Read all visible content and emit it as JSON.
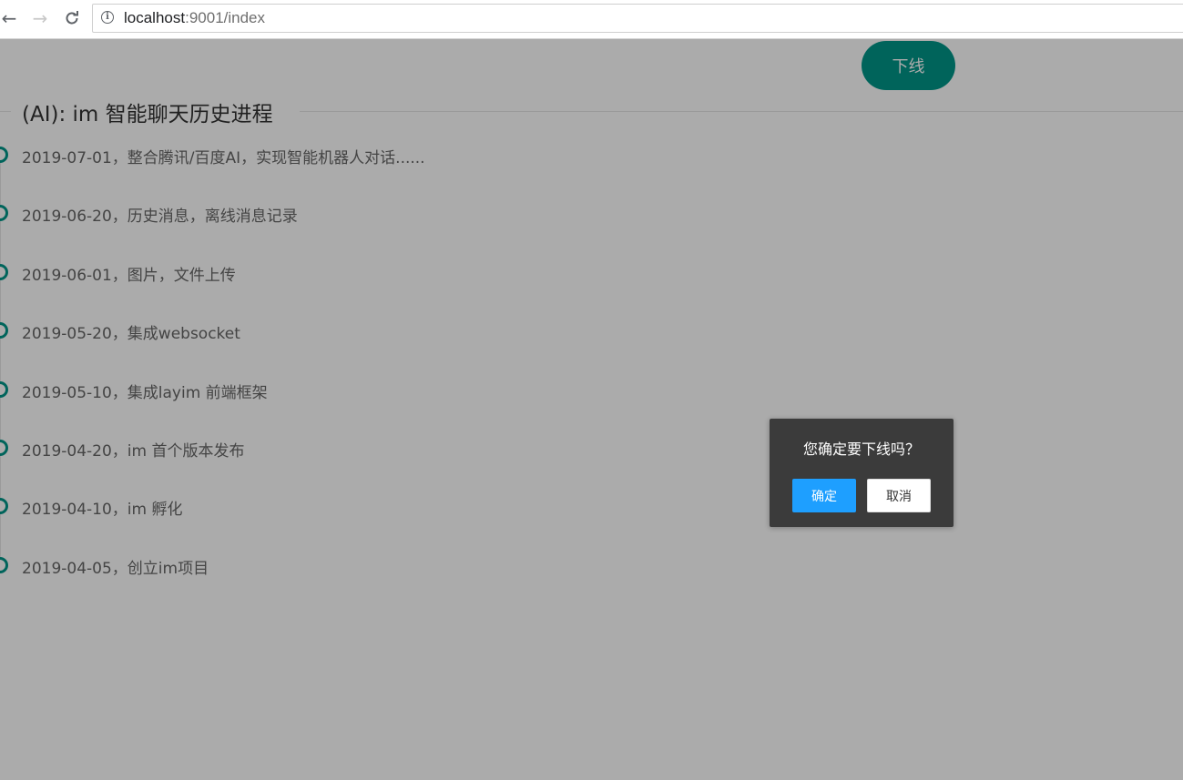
{
  "browser": {
    "back_icon": "arrow-left-icon",
    "forward_icon": "arrow-right-icon",
    "reload_icon": "reload-icon",
    "url_host": "localhost",
    "url_path": ":9001/index"
  },
  "header": {
    "logout_label": "下线"
  },
  "section": {
    "title": "(AI): im 智能聊天历史进程"
  },
  "timeline": [
    "2019-07-01，整合腾讯/百度AI，实现智能机器人对话......",
    "2019-06-20，历史消息，离线消息记录",
    "2019-06-01，图片，文件上传",
    "2019-05-20，集成websocket",
    "2019-05-10，集成layim 前端框架",
    "2019-04-20，im 首个版本发布",
    "2019-04-10，im 孵化",
    "2019-04-05，创立im项目"
  ],
  "dialog": {
    "message": "您确定要下线吗？",
    "confirm_label": "确定",
    "cancel_label": "取消"
  },
  "colors": {
    "accent": "#009688",
    "confirm": "#1e9fff",
    "dialog_bg": "#3b3b3b"
  }
}
